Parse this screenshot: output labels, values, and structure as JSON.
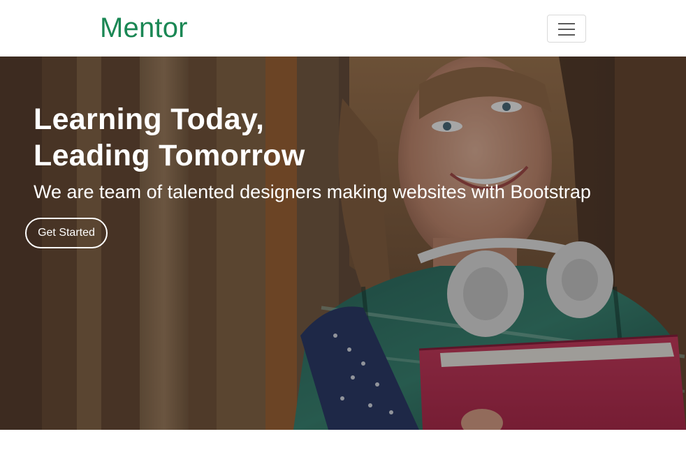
{
  "navbar": {
    "brand": "Mentor",
    "brand_color": "#1a8754",
    "toggle_icon": "hamburger-menu-icon"
  },
  "hero": {
    "title_line1": "Learning Today,",
    "title_line2": "Leading Tomorrow",
    "subtitle": "We are team of talented designers making websites with Bootstrap",
    "cta_label": "Get Started",
    "background_image": "student-with-headphones-and-books-photo"
  }
}
